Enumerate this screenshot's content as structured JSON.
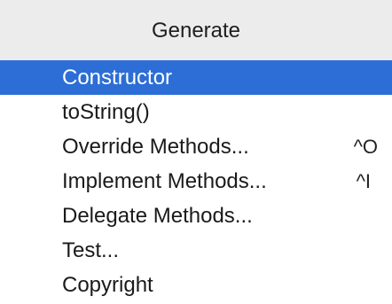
{
  "popup": {
    "title": "Generate",
    "items": [
      {
        "label": "Constructor",
        "shortcut": "",
        "selected": true
      },
      {
        "label": "toString()",
        "shortcut": "",
        "selected": false
      },
      {
        "label": "Override Methods...",
        "shortcut": "^O",
        "selected": false
      },
      {
        "label": "Implement Methods...",
        "shortcut": "^I",
        "selected": false
      },
      {
        "label": "Delegate Methods...",
        "shortcut": "",
        "selected": false
      },
      {
        "label": "Test...",
        "shortcut": "",
        "selected": false
      },
      {
        "label": "Copyright",
        "shortcut": "",
        "selected": false
      }
    ]
  },
  "colors": {
    "header_bg": "#ececec",
    "selection_bg": "#2c6ed6",
    "text": "#1a1a1a"
  }
}
